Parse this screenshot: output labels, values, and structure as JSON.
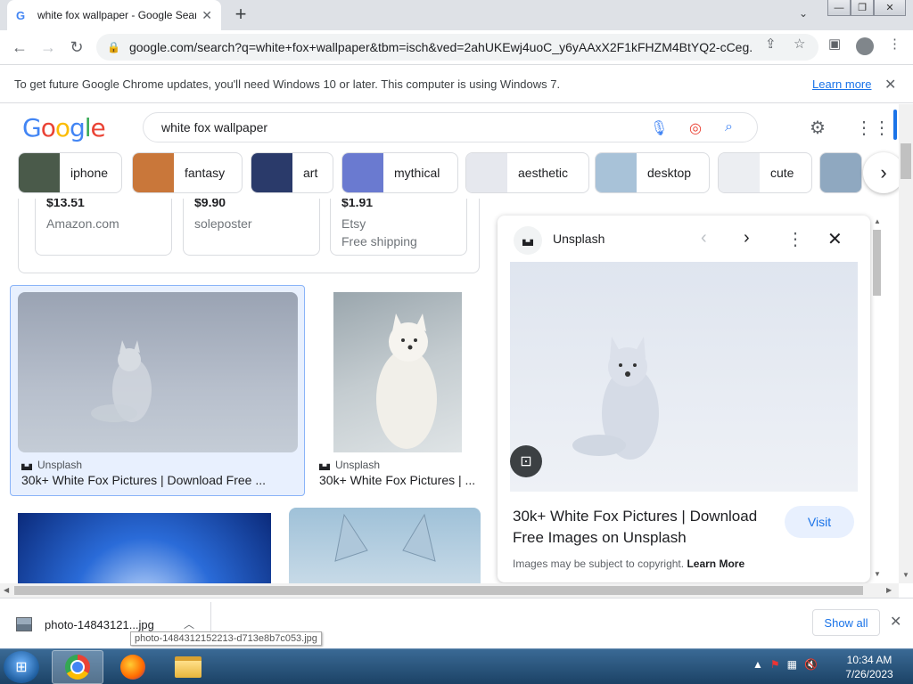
{
  "browser": {
    "tab_title": "white fox wallpaper - Google Search",
    "tab_favicon": "G",
    "url": "google.com/search?q=white+fox+wallpaper&tbm=isch&ved=2ahUKEwj4uoC_y6yAAxX2F1kFHZM4BtYQ2-cCeg..."
  },
  "infobar": {
    "message": "To get future Google Chrome updates, you'll need Windows 10 or later. This computer is using Windows 7.",
    "learn_more": "Learn more"
  },
  "google": {
    "logo": [
      "G",
      "o",
      "o",
      "g",
      "l",
      "e"
    ],
    "query": "white fox wallpaper"
  },
  "chips": [
    {
      "label": "iphone",
      "color": "#4a5a4a"
    },
    {
      "label": "fantasy",
      "color": "#c9773a"
    },
    {
      "label": "art",
      "color": "#2a3a6a"
    },
    {
      "label": "mythical",
      "color": "#6a7ad0"
    },
    {
      "label": "aesthetic",
      "color": "#e6e8ee"
    },
    {
      "label": "desktop",
      "color": "#a8c2d8"
    },
    {
      "label": "cute",
      "color": "#eceef2"
    }
  ],
  "shopping": [
    {
      "price": "$13.51",
      "seller": "Amazon.com",
      "shipping": ""
    },
    {
      "price": "$9.90",
      "seller": "soleposter",
      "shipping": ""
    },
    {
      "price": "$1.91",
      "seller": "Etsy",
      "shipping": "Free shipping"
    }
  ],
  "results": [
    {
      "source": "Unsplash",
      "title": "30k+ White Fox Pictures | Download Free ..."
    },
    {
      "source": "Unsplash",
      "title": "30k+ White Fox Pictures | ..."
    }
  ],
  "panel": {
    "source": "Unsplash",
    "title": "30k+ White Fox Pictures | Download Free Images on Unsplash",
    "visit": "Visit",
    "copyright": "Images may be subject to copyright.",
    "learn_more": "Learn More"
  },
  "downloads": {
    "file_name": "photo-14843121...jpg",
    "tooltip": "photo-1484312152213-d713e8b7c053.jpg",
    "show_all": "Show all"
  },
  "taskbar": {
    "time": "10:34 AM",
    "date": "7/26/2023"
  }
}
